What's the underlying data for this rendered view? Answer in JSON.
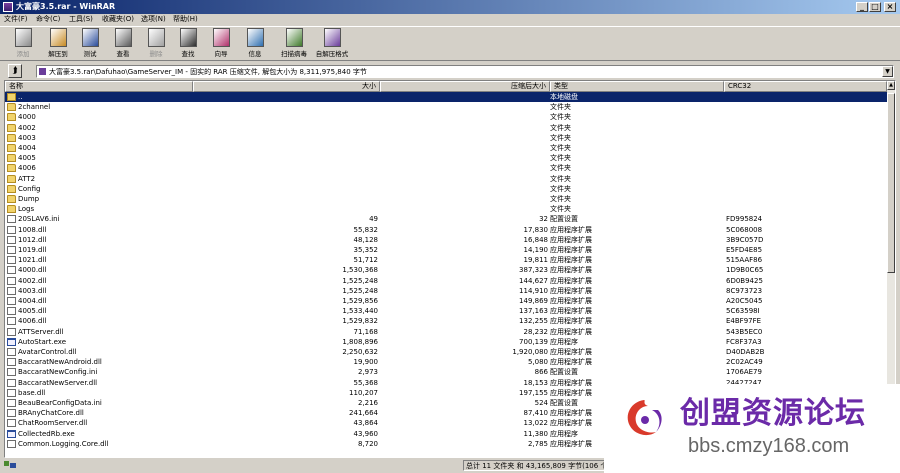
{
  "window": {
    "title": "大富豪3.5.rar - WinRAR",
    "controls": {
      "minimize": "_",
      "maximize": "□",
      "close": "×"
    }
  },
  "menu": [
    "文件(F)",
    "命令(C)",
    "工具(S)",
    "收藏夹(O)",
    "选项(N)",
    "帮助(H)"
  ],
  "toolbar": [
    {
      "label": "添加",
      "icon": "add-icon",
      "disabled": true,
      "color": "#8a8a8a"
    },
    {
      "label": "解压到",
      "icon": "extract-icon",
      "disabled": false,
      "color": "#c78a22"
    },
    {
      "label": "测试",
      "icon": "test-icon",
      "disabled": false,
      "color": "#2a4c9a"
    },
    {
      "label": "查看",
      "icon": "view-icon",
      "disabled": false,
      "color": "#5a5a5a"
    },
    {
      "label": "删除",
      "icon": "delete-icon",
      "disabled": true,
      "color": "#a0a0a0"
    },
    {
      "label": "查找",
      "icon": "find-icon",
      "disabled": false,
      "color": "#2d2d2d"
    },
    {
      "label": "向导",
      "icon": "wizard-icon",
      "disabled": false,
      "color": "#b0306a"
    },
    {
      "label": "信息",
      "icon": "info-icon",
      "disabled": false,
      "color": "#2f6fb0"
    },
    {
      "label": "扫描病毒",
      "icon": "scan-virus-icon",
      "disabled": false,
      "color": "#3f7a2a"
    },
    {
      "label": "自解压格式",
      "icon": "sfx-icon",
      "disabled": false,
      "color": "#6a3c9a"
    }
  ],
  "address": {
    "up_glyph": "⮭",
    "path": "大富豪3.5.rar\\Dafuhao\\GameServer_IM - 固实的 RAR 压缩文件, 解包大小为 8,311,975,840 字节",
    "dropdown": "▼"
  },
  "columns": {
    "name": "名称",
    "size": "大小",
    "packed": "压缩后大小",
    "type": "类型",
    "crc": "CRC32"
  },
  "files": [
    {
      "name": "..",
      "size": "",
      "packed": "",
      "type": "本地磁盘",
      "crc": "",
      "kind": "parent",
      "selected": true
    },
    {
      "name": "2channel",
      "size": "",
      "packed": "",
      "type": "文件夹",
      "crc": "",
      "kind": "folder"
    },
    {
      "name": "4000",
      "size": "",
      "packed": "",
      "type": "文件夹",
      "crc": "",
      "kind": "folder"
    },
    {
      "name": "4002",
      "size": "",
      "packed": "",
      "type": "文件夹",
      "crc": "",
      "kind": "folder"
    },
    {
      "name": "4003",
      "size": "",
      "packed": "",
      "type": "文件夹",
      "crc": "",
      "kind": "folder"
    },
    {
      "name": "4004",
      "size": "",
      "packed": "",
      "type": "文件夹",
      "crc": "",
      "kind": "folder"
    },
    {
      "name": "4005",
      "size": "",
      "packed": "",
      "type": "文件夹",
      "crc": "",
      "kind": "folder"
    },
    {
      "name": "4006",
      "size": "",
      "packed": "",
      "type": "文件夹",
      "crc": "",
      "kind": "folder"
    },
    {
      "name": "ATT2",
      "size": "",
      "packed": "",
      "type": "文件夹",
      "crc": "",
      "kind": "folder"
    },
    {
      "name": "Config",
      "size": "",
      "packed": "",
      "type": "文件夹",
      "crc": "",
      "kind": "folder"
    },
    {
      "name": "Dump",
      "size": "",
      "packed": "",
      "type": "文件夹",
      "crc": "",
      "kind": "folder"
    },
    {
      "name": "Logs",
      "size": "",
      "packed": "",
      "type": "文件夹",
      "crc": "",
      "kind": "folder"
    },
    {
      "name": "20SLAV6.ini",
      "size": "49",
      "packed": "32",
      "type": "配置设置",
      "crc": "FD995824",
      "kind": "file"
    },
    {
      "name": "1008.dll",
      "size": "55,832",
      "packed": "17,830",
      "type": "应用程序扩展",
      "crc": "5C068008",
      "kind": "file"
    },
    {
      "name": "1012.dll",
      "size": "48,128",
      "packed": "16,848",
      "type": "应用程序扩展",
      "crc": "3B9C057D",
      "kind": "file"
    },
    {
      "name": "1019.dll",
      "size": "35,352",
      "packed": "14,190",
      "type": "应用程序扩展",
      "crc": "E5FD4E85",
      "kind": "file"
    },
    {
      "name": "1021.dll",
      "size": "51,712",
      "packed": "19,811",
      "type": "应用程序扩展",
      "crc": "515AAF86",
      "kind": "file"
    },
    {
      "name": "4000.dll",
      "size": "1,530,368",
      "packed": "387,323",
      "type": "应用程序扩展",
      "crc": "1D9B0C65",
      "kind": "file"
    },
    {
      "name": "4002.dll",
      "size": "1,525,248",
      "packed": "144,627",
      "type": "应用程序扩展",
      "crc": "6D0B9425",
      "kind": "file"
    },
    {
      "name": "4003.dll",
      "size": "1,525,248",
      "packed": "114,910",
      "type": "应用程序扩展",
      "crc": "8C973723",
      "kind": "file"
    },
    {
      "name": "4004.dll",
      "size": "1,529,856",
      "packed": "149,869",
      "type": "应用程序扩展",
      "crc": "A20C5045",
      "kind": "file"
    },
    {
      "name": "4005.dll",
      "size": "1,533,440",
      "packed": "137,163",
      "type": "应用程序扩展",
      "crc": "5C63598I",
      "kind": "file"
    },
    {
      "name": "4006.dll",
      "size": "1,529,832",
      "packed": "132,255",
      "type": "应用程序扩展",
      "crc": "E4BF97FE",
      "kind": "file"
    },
    {
      "name": "ATTServer.dll",
      "size": "71,168",
      "packed": "28,232",
      "type": "应用程序扩展",
      "crc": "543B5EC0",
      "kind": "file"
    },
    {
      "name": "AutoStart.exe",
      "size": "1,808,896",
      "packed": "700,139",
      "type": "应用程序",
      "crc": "FC8F37A3",
      "kind": "exe"
    },
    {
      "name": "AvatarControl.dll",
      "size": "2,250,632",
      "packed": "1,920,080",
      "type": "应用程序扩展",
      "crc": "D40DAB2B",
      "kind": "file"
    },
    {
      "name": "BaccaratNewAndroid.dll",
      "size": "19,900",
      "packed": "5,080",
      "type": "应用程序扩展",
      "crc": "2C02AC49",
      "kind": "file"
    },
    {
      "name": "BaccaratNewConfig.ini",
      "size": "2,973",
      "packed": "866",
      "type": "配置设置",
      "crc": "1706AE79",
      "kind": "file"
    },
    {
      "name": "BaccaratNewServer.dll",
      "size": "55,368",
      "packed": "18,153",
      "type": "应用程序扩展",
      "crc": "24427247",
      "kind": "file"
    },
    {
      "name": "base.dll",
      "size": "110,207",
      "packed": "197,155",
      "type": "应用程序扩展",
      "crc": "",
      "kind": "file"
    },
    {
      "name": "BeauBearConfigData.ini",
      "size": "2,216",
      "packed": "524",
      "type": "配置设置",
      "crc": "",
      "kind": "file"
    },
    {
      "name": "BRAnyChatCore.dll",
      "size": "241,664",
      "packed": "87,410",
      "type": "应用程序扩展",
      "crc": "",
      "kind": "file"
    },
    {
      "name": "ChatRoomServer.dll",
      "size": "43,864",
      "packed": "13,022",
      "type": "应用程序扩展",
      "crc": "",
      "kind": "file"
    },
    {
      "name": "CollectedRb.exe",
      "size": "43,960",
      "packed": "11,380",
      "type": "应用程序",
      "crc": "",
      "kind": "exe"
    },
    {
      "name": "Common.Logging.Core.dll",
      "size": "8,720",
      "packed": "2,785",
      "type": "应用程序扩展",
      "crc": "",
      "kind": "file"
    }
  ],
  "status": {
    "text": "总计 11 文件夹 和 43,165,809 字节(106 个文件)"
  },
  "watermark": {
    "title": "创盟资源论坛",
    "url": "bbs.cmzy168.com"
  },
  "colors": {
    "title_bar": "#0a246a",
    "selection": "#0a246a",
    "chrome": "#d4d0c8",
    "watermark_accent": "#6b2aa8",
    "watermark_logo": "#d93a2b"
  }
}
